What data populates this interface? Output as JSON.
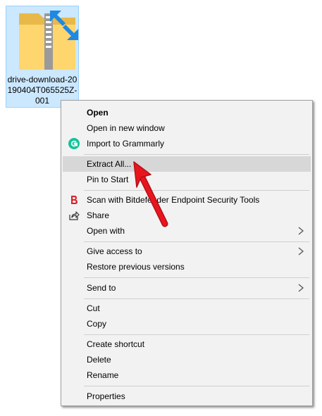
{
  "desktop": {
    "file_label": "drive-download-20190404T065525Z-001"
  },
  "menu": {
    "items": [
      {
        "label": "Open"
      },
      {
        "label": "Open in new window"
      },
      {
        "label": "Import to Grammarly"
      },
      {
        "label": "Extract All..."
      },
      {
        "label": "Pin to Start"
      },
      {
        "label": "Scan with Bitdefender Endpoint Security Tools"
      },
      {
        "label": "Share"
      },
      {
        "label": "Open with"
      },
      {
        "label": "Give access to"
      },
      {
        "label": "Restore previous versions"
      },
      {
        "label": "Send to"
      },
      {
        "label": "Cut"
      },
      {
        "label": "Copy"
      },
      {
        "label": "Create shortcut"
      },
      {
        "label": "Delete"
      },
      {
        "label": "Rename"
      },
      {
        "label": "Properties"
      }
    ]
  },
  "icons": {
    "file": "zip-folder-icon",
    "grammarly": "grammarly-icon",
    "bitdefender": "bitdefender-icon",
    "share": "share-icon",
    "submenu": "chevron-right-icon",
    "annotation": "red-arrow-icon"
  },
  "colors": {
    "selection_bg": "#cce8ff",
    "menu_bg": "#f2f2f2",
    "highlight_bg": "#d7d7d7",
    "grammarly_green": "#15c39a",
    "bitdefender_red": "#d9232e",
    "arrow_red": "#e8151f"
  }
}
